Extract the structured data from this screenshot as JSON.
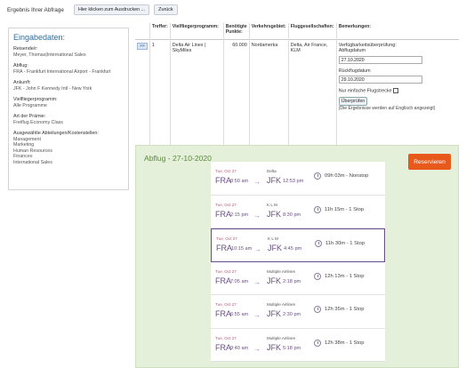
{
  "topbar": {
    "title": "Ergebnis Ihrer Abfrage",
    "print_label": "Hier klicken zum Ausdrucken ...",
    "back_label": "Zurück"
  },
  "panel": {
    "heading": "Eingabedaten:",
    "traveler_label": "Reisende/r:",
    "traveler_value": "Meyer, Thomas|International Sales",
    "departure_label": "Abflug:",
    "departure_value": "FRA - Frankfurt International Airport - Frankfurt",
    "arrival_label": "Ankunft:",
    "arrival_value": "JFK - John F Kennedy Intl - New York",
    "program_label": "Vielfliegerprogramm:",
    "program_value": "Alle Programme",
    "award_label": "Art der Prämie:",
    "award_value": "Freiflug Economy Class",
    "departments_label": "Ausgewählte Abteilungen/Kostenstellen:",
    "departments": [
      "Management",
      "Marketing",
      "Human Resources",
      "Finances",
      "International Sales"
    ]
  },
  "results": {
    "headers": {
      "treffer": "Treffer:",
      "program": "Vielfliegerprogramm:",
      "points": "Benötigte Punkte:",
      "region": "Verkehrsgebiet:",
      "airlines": "Fluggesellschaften:",
      "remarks": "Bemerkungen:"
    },
    "row": {
      "expand": ">>",
      "index": "1",
      "program": "Delta Air Lines | SkyMiles",
      "points": "60.000",
      "region": "Nordamerka",
      "airlines": "Delta, Air France, KLM"
    },
    "check": {
      "title": "Verfügbarkeitsüberprüfung:",
      "depart_label": "Abflugdatum",
      "depart_value": "27.10.2020",
      "return_label": "Rückflugdatum",
      "return_value": "29.10.2020",
      "oneway_label": "Nur einfache Flugstrecke",
      "button": "Überprüfen",
      "note": "(Die Ergebnisse werden auf Englisch angezeigt)"
    }
  },
  "flights_panel": {
    "title": "Abflug - 27-10-2020",
    "reserve": "Reservieren",
    "flights": [
      {
        "date": "Tue, Oct 27",
        "airline": "Delta",
        "from": "FRA",
        "dep": "8:50 am",
        "to": "JFK",
        "arr": "12:53 pm",
        "duration": "09h 03m - Nonstop"
      },
      {
        "date": "Tue, Oct 27",
        "airline": "K L M",
        "from": "FRA",
        "dep": "2:15 pm",
        "to": "JFK",
        "arr": "8:30 pm",
        "duration": "11h 15m - 1 Stop"
      },
      {
        "date": "Tue, Oct 27",
        "airline": "K L M",
        "from": "FRA",
        "dep": "10:15 am",
        "to": "JFK",
        "arr": "4:45 pm",
        "duration": "11h 30m - 1 Stop"
      },
      {
        "date": "Tue, Oct 27",
        "airline": "Multiple Airlines",
        "from": "FRA",
        "dep": "7:05 am",
        "to": "JFK",
        "arr": "2:18 pm",
        "duration": "12h 13m - 1 Stop"
      },
      {
        "date": "Tue, Oct 27",
        "airline": "Multiple Airlines",
        "from": "FRA",
        "dep": "6:55 am",
        "to": "JFK",
        "arr": "2:30 pm",
        "duration": "12h 35m - 1 Stop"
      },
      {
        "date": "Tue, Oct 27",
        "airline": "Multiple Airlines",
        "from": "FRA",
        "dep": "9:40 am",
        "to": "JFK",
        "arr": "5:18 pm",
        "duration": "12h 38m - 1 Stop"
      }
    ]
  },
  "colors": {
    "heading_blue": "#2f6d9c",
    "flight_purple": "#6a4e85",
    "panel_green": "#e5f0da",
    "reserve_orange": "#e8591c"
  }
}
